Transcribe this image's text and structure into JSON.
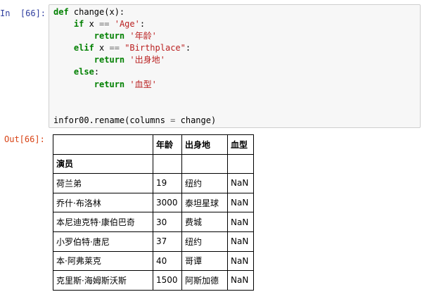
{
  "input_prompt": "In  [66]:",
  "output_prompt": "Out[66]:",
  "code": {
    "line1": {
      "kw": "def",
      "rest": " change(x):"
    },
    "line2": {
      "kw": "if",
      "mid": " x ",
      "op": "==",
      "sp": " ",
      "str": "'Age'",
      "end": ":"
    },
    "line3": {
      "kw": "return",
      "sp": " ",
      "str": "'年龄'"
    },
    "line4": {
      "kw": "elif",
      "mid": " x ",
      "op": "==",
      "sp": " ",
      "str": "\"Birthplace\"",
      "end": ":"
    },
    "line5": {
      "kw": "return",
      "sp": " ",
      "str": "'出身地'"
    },
    "line6": {
      "kw": "else",
      "end": ":"
    },
    "line7": {
      "kw": "return",
      "sp": " ",
      "str": "'血型'"
    },
    "line9": {
      "pre": "infor00.rename(columns ",
      "op": "=",
      "post": " change)"
    }
  },
  "table": {
    "columns": [
      "",
      "年龄",
      "出身地",
      "血型"
    ],
    "index_name": "演员",
    "rows": [
      [
        "荷兰弟",
        "19",
        "纽约",
        "NaN"
      ],
      [
        "乔什·布洛林",
        "3000",
        "泰坦星球",
        "NaN"
      ],
      [
        "本尼迪克特·康伯巴奇",
        "30",
        "费城",
        "NaN"
      ],
      [
        "小罗伯特·唐尼",
        "37",
        "纽约",
        "NaN"
      ],
      [
        "本·阿弗莱克",
        "40",
        "哥谭",
        "NaN"
      ],
      [
        "克里斯·海姆斯沃斯",
        "1500",
        "阿斯加德",
        "NaN"
      ]
    ]
  }
}
